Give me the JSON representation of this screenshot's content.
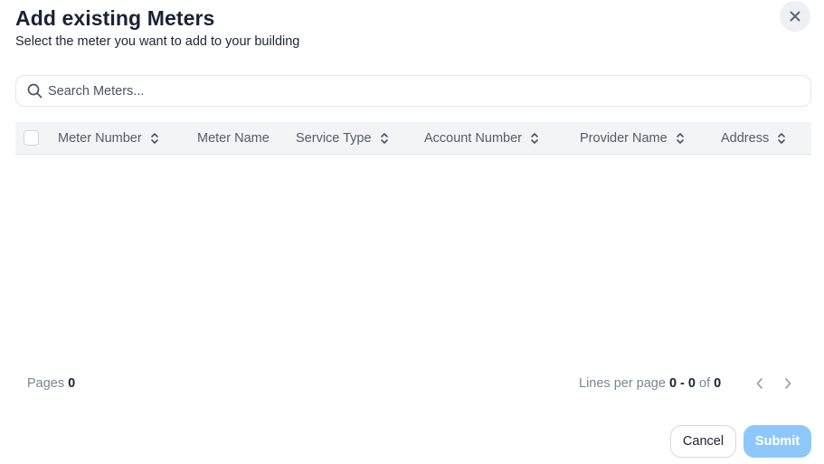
{
  "dialog": {
    "title": "Add existing Meters",
    "subtitle": "Select the meter you want to add to your building"
  },
  "search": {
    "placeholder": "Search Meters...",
    "value": ""
  },
  "table": {
    "columns": [
      {
        "label": "Meter Number",
        "sortable": true
      },
      {
        "label": "Meter Name",
        "sortable": false
      },
      {
        "label": "Service Type",
        "sortable": true
      },
      {
        "label": "Account Number",
        "sortable": true
      },
      {
        "label": "Provider Name",
        "sortable": true
      },
      {
        "label": "Address",
        "sortable": true
      }
    ],
    "rows": []
  },
  "pagination": {
    "pages_label": "Pages",
    "pages_value": "0",
    "lines_label": "Lines per page",
    "range_value": "0 - 0",
    "of_label": "of",
    "total_value": "0"
  },
  "buttons": {
    "cancel": "Cancel",
    "submit": "Submit"
  },
  "colors": {
    "submit_bg": "#8ec8fb",
    "header_bg": "#f3f4f6",
    "title": "#1b2236"
  },
  "icons": {
    "close": "close-icon",
    "search": "search-icon",
    "sort": "sort-icon",
    "prev": "chevron-left-icon",
    "next": "chevron-right-icon"
  }
}
